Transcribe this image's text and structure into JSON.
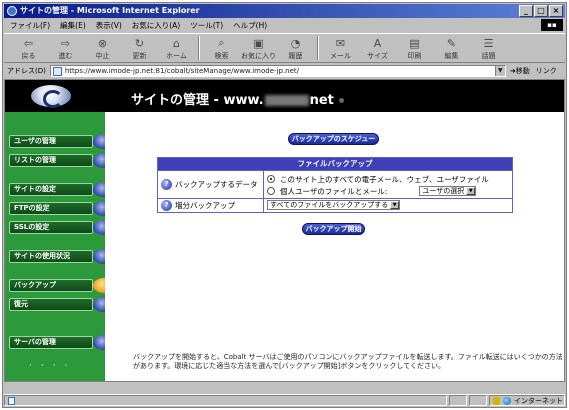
{
  "window": {
    "title": "サイトの管理 - Microsoft Internet Explorer",
    "buttons": [
      "_",
      "□",
      "×"
    ]
  },
  "menubar": {
    "items": [
      "ファイル(F)",
      "編集(E)",
      "表示(V)",
      "お気に入り(A)",
      "ツール(T)",
      "ヘルプ(H)"
    ]
  },
  "toolbar": {
    "buttons": [
      {
        "label": "戻る",
        "icon": "back-arrow-icon"
      },
      {
        "label": "進む",
        "icon": "forward-arrow-icon"
      },
      {
        "label": "中止",
        "icon": "stop-icon"
      },
      {
        "label": "更新",
        "icon": "refresh-icon"
      },
      {
        "label": "ホーム",
        "icon": "home-icon"
      },
      {
        "label": "検索",
        "icon": "search-icon"
      },
      {
        "label": "お気に入り",
        "icon": "favorites-icon"
      },
      {
        "label": "履歴",
        "icon": "history-icon"
      },
      {
        "label": "メール",
        "icon": "mail-icon"
      },
      {
        "label": "サイズ",
        "icon": "font-size-icon"
      },
      {
        "label": "印刷",
        "icon": "print-icon"
      },
      {
        "label": "編集",
        "icon": "edit-icon"
      },
      {
        "label": "話題",
        "icon": "discuss-icon"
      }
    ]
  },
  "address": {
    "label": "アドレス(D)",
    "url": "https://www.imode-jp.net:81/cobalt/siteManage/www.imode-jp.net/",
    "go": "移動",
    "links": "リンク"
  },
  "header": {
    "title_prefix": "サイトの管理 - www.",
    "title_suffix": "net"
  },
  "sidebar": {
    "items": [
      {
        "label": "ユーザの管理"
      },
      {
        "label": "リストの管理"
      },
      {
        "label": "サイトの設定"
      },
      {
        "label": "FTPの設定"
      },
      {
        "label": "SSLの設定"
      },
      {
        "label": "サイトの使用状況"
      },
      {
        "label": "バックアップ"
      },
      {
        "label": "復元"
      },
      {
        "label": "サーバの管理"
      }
    ],
    "active_index": 6
  },
  "main": {
    "schedule_button": "バックアップのスケジュール",
    "panel_title": "ファイルバックアップ",
    "backup_data_label": "バックアップするデータ",
    "option_all": "このサイト上のすべての電子メール、ウェブ、ユーザファイル",
    "option_user": "個人ユーザのファイルとメール:",
    "user_select": "ユーザの選択",
    "incremental_label": "増分バックアップ",
    "incremental_value": "すべてのファイルをバックアップする",
    "start_button": "バックアップ開始",
    "footer": "バックアップを開始すると、Cobalt サーバはご使用のパソコンにバックアップファイルを転送します。ファイル転送にはいくつかの方法があります。環境に応じた適当な方法を選んで[バックアップ開始]ボタンをクリックしてください。"
  },
  "status": {
    "zone": "インターネット"
  }
}
